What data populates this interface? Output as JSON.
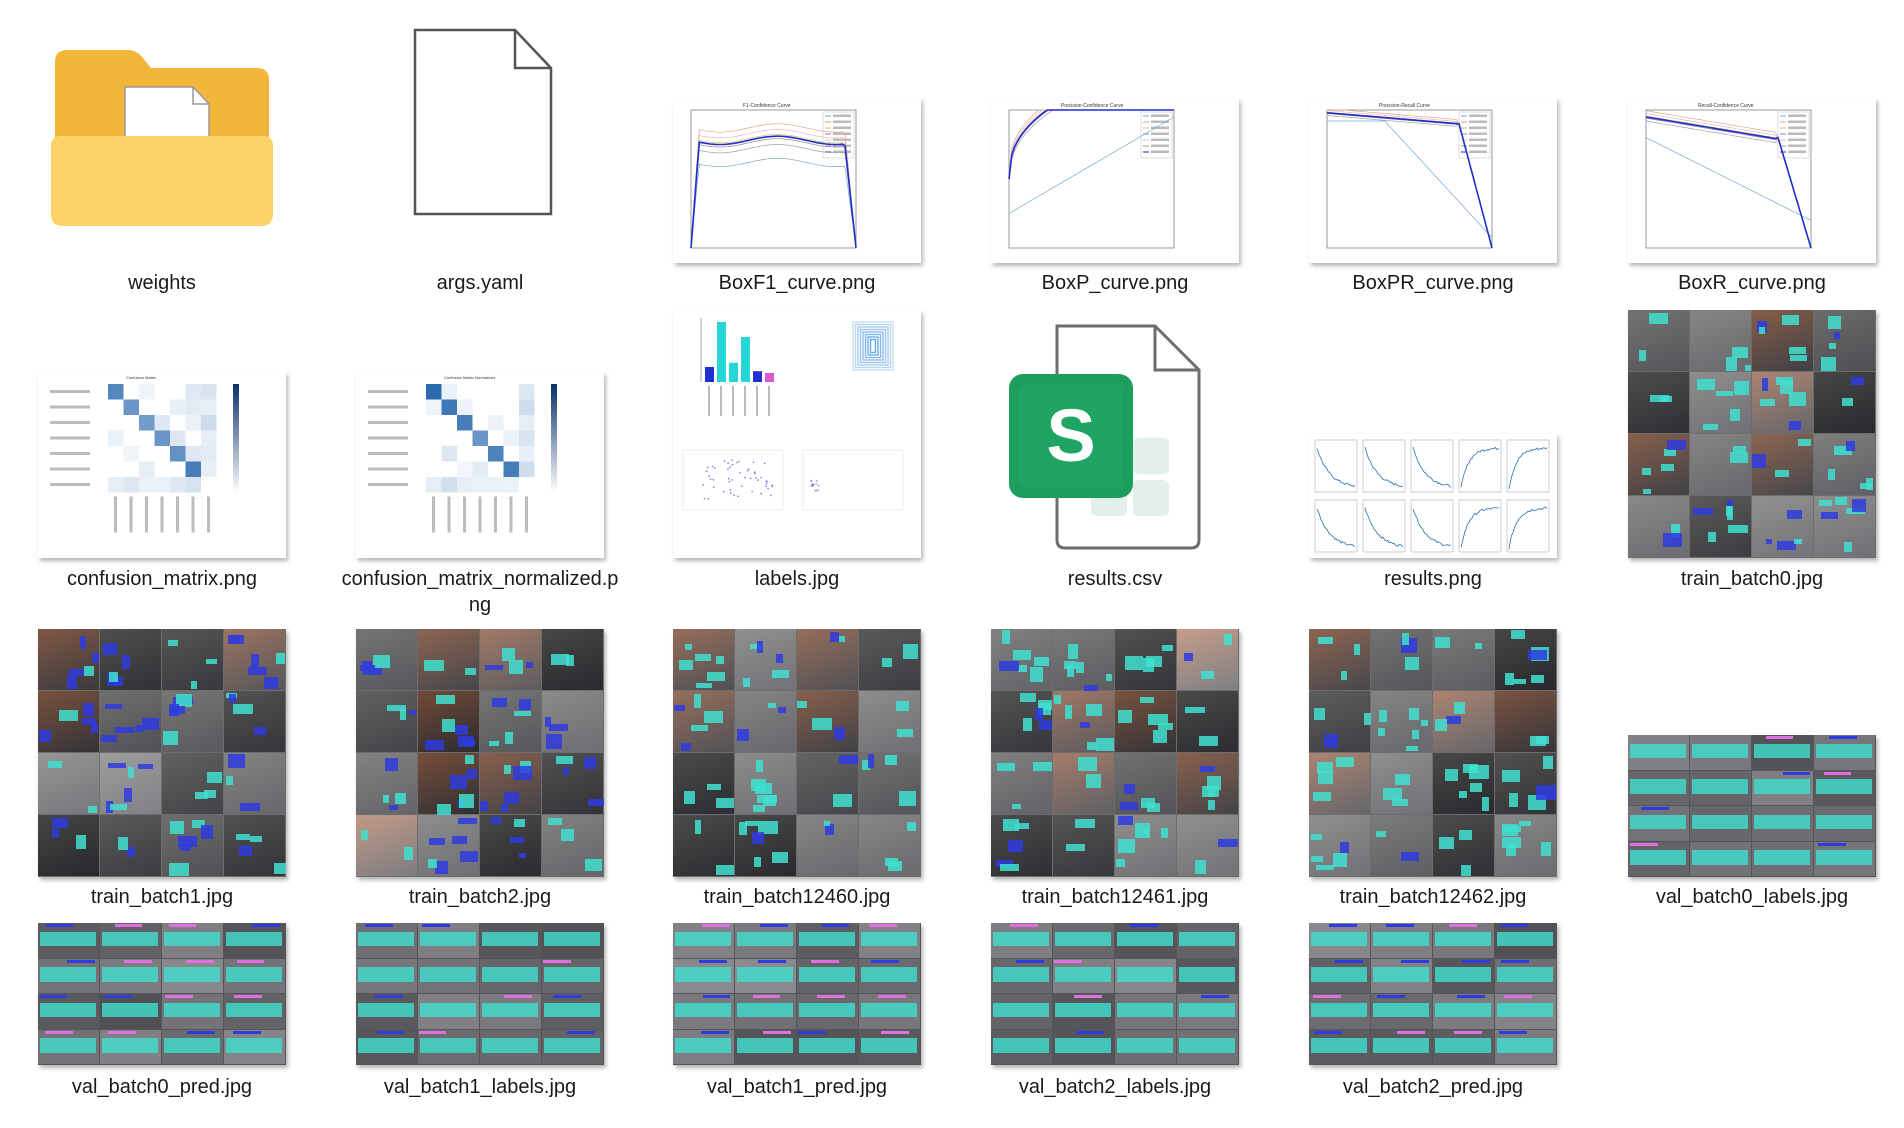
{
  "colors": {
    "folder_back": "#F2B63B",
    "folder_front": "#FCD46A",
    "excel_green": "#1D9E5C",
    "heat_blue": "#1B5FA8",
    "bbox_cyan": "#40E0D0",
    "bbox_blue": "#2E3BE0"
  },
  "files": [
    {
      "name": "weights",
      "kind": "folder",
      "icon": "folder-icon"
    },
    {
      "name": "args.yaml",
      "kind": "blank",
      "icon": "blank-file-icon"
    },
    {
      "name": "BoxF1_curve.png",
      "kind": "curve",
      "icon": "f1-curve-thumbnail",
      "chart_title": "F1-Confidence Curve",
      "curve": "f1"
    },
    {
      "name": "BoxP_curve.png",
      "kind": "curve",
      "icon": "precision-curve-thumbnail",
      "chart_title": "Precision-Confidence Curve",
      "curve": "p"
    },
    {
      "name": "BoxPR_curve.png",
      "kind": "curve",
      "icon": "pr-curve-thumbnail",
      "chart_title": "Precision-Recall Curve",
      "curve": "pr"
    },
    {
      "name": "BoxR_curve.png",
      "kind": "curve",
      "icon": "recall-curve-thumbnail",
      "chart_title": "Recall-Confidence Curve",
      "curve": "r"
    },
    {
      "name": "confusion_matrix.png",
      "kind": "matrix",
      "icon": "confusion-matrix-thumbnail",
      "chart_title": "Confusion Matrix"
    },
    {
      "name": "confusion_matrix_normalized.png",
      "kind": "matrix",
      "icon": "confusion-matrix-normalized-thumbnail",
      "chart_title": "Confusion Matrix Normalized"
    },
    {
      "name": "labels.jpg",
      "kind": "labels",
      "icon": "labels-thumbnail"
    },
    {
      "name": "results.csv",
      "kind": "excel",
      "icon": "excel-file-icon",
      "glyph": "S"
    },
    {
      "name": "results.png",
      "kind": "results",
      "icon": "results-plot-thumbnail"
    },
    {
      "name": "train_batch0.jpg",
      "kind": "mosaic",
      "icon": "image-mosaic-thumbnail"
    },
    {
      "name": "train_batch1.jpg",
      "kind": "mosaic",
      "icon": "image-mosaic-thumbnail"
    },
    {
      "name": "train_batch2.jpg",
      "kind": "mosaic",
      "icon": "image-mosaic-thumbnail"
    },
    {
      "name": "train_batch12460.jpg",
      "kind": "mosaic",
      "icon": "image-mosaic-thumbnail"
    },
    {
      "name": "train_batch12461.jpg",
      "kind": "mosaic",
      "icon": "image-mosaic-thumbnail"
    },
    {
      "name": "train_batch12462.jpg",
      "kind": "mosaic",
      "icon": "image-mosaic-thumbnail"
    },
    {
      "name": "val_batch0_labels.jpg",
      "kind": "valwide",
      "icon": "image-mosaic-thumbnail"
    },
    {
      "name": "val_batch0_pred.jpg",
      "kind": "valwide",
      "icon": "image-mosaic-thumbnail"
    },
    {
      "name": "val_batch1_labels.jpg",
      "kind": "valwide",
      "icon": "image-mosaic-thumbnail"
    },
    {
      "name": "val_batch1_pred.jpg",
      "kind": "valwide",
      "icon": "image-mosaic-thumbnail"
    },
    {
      "name": "val_batch2_labels.jpg",
      "kind": "valwide",
      "icon": "image-mosaic-thumbnail"
    },
    {
      "name": "val_batch2_pred.jpg",
      "kind": "valwide",
      "icon": "image-mosaic-thumbnail"
    }
  ]
}
